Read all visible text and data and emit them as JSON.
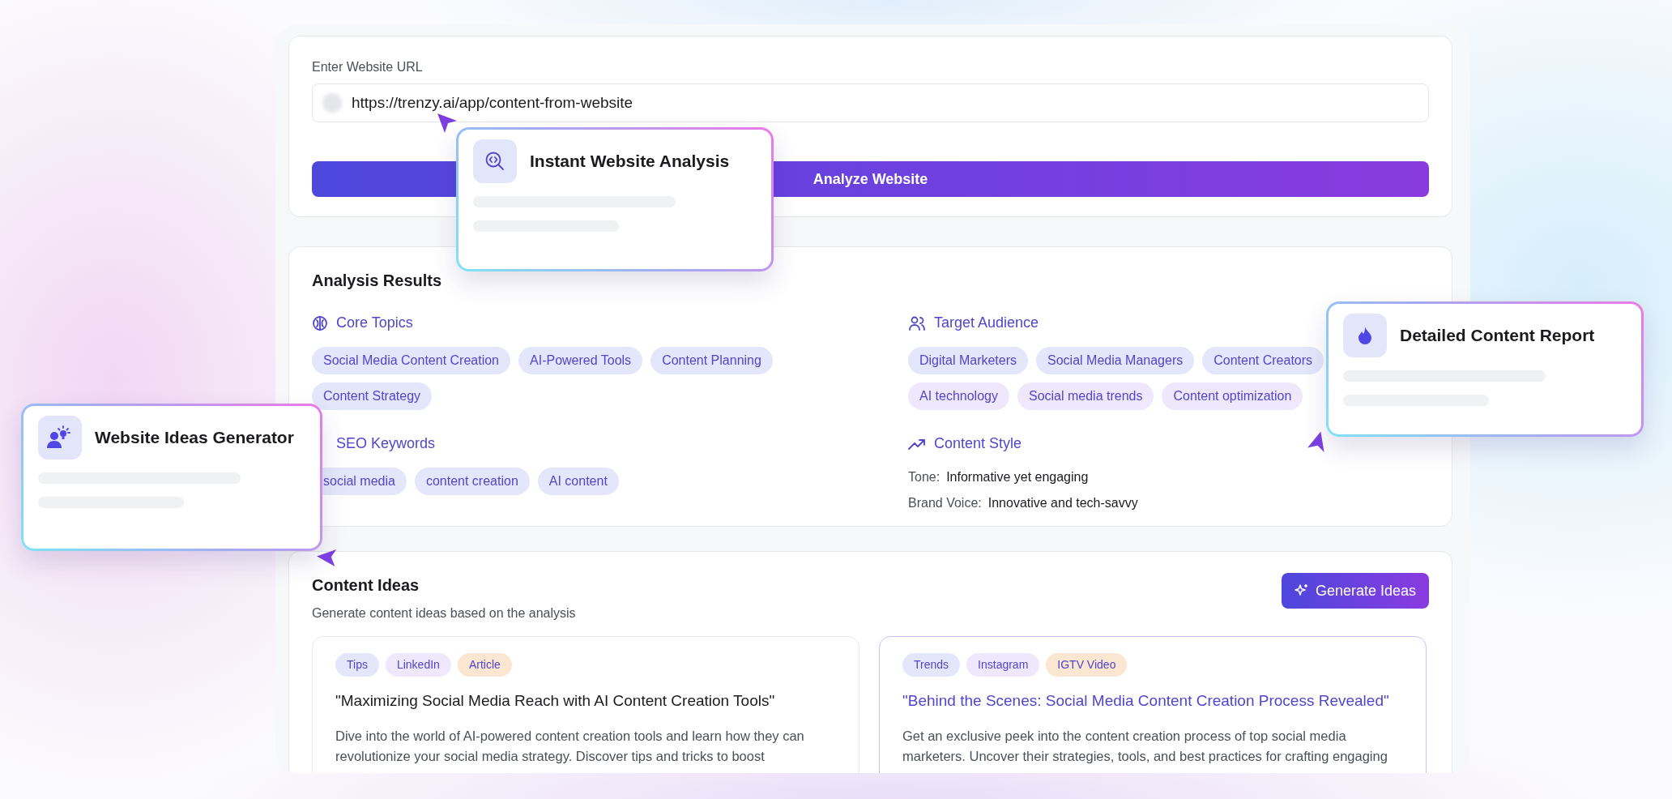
{
  "url_card": {
    "label": "Enter Website URL",
    "url": "https://trenzy.ai/app/content-from-website",
    "button": "Analyze Website"
  },
  "analysis": {
    "title": "Analysis Results",
    "columns": [
      [
        {
          "kind": "tags",
          "title": "Core Topics",
          "tags": [
            {
              "text": "Social Media Content Creation",
              "color": "#e4e7fb"
            },
            {
              "text": "AI-Powered Tools",
              "color": "#e4e7fb"
            },
            {
              "text": "Content Planning",
              "color": "#e4e7fb"
            },
            {
              "text": "Content Strategy",
              "color": "#e4e7fb"
            }
          ]
        },
        {
          "kind": "tags",
          "title": "SEO Keywords",
          "tags": [
            {
              "text": "social media",
              "color": "#e4e7fb"
            },
            {
              "text": "content creation",
              "color": "#e4e7fb"
            },
            {
              "text": "AI content",
              "color": "#e4e7fb"
            }
          ]
        }
      ],
      [
        {
          "kind": "tags",
          "title": "Target Audience",
          "tags": [
            {
              "text": "Digital Marketers",
              "color": "#e4e7fb"
            },
            {
              "text": "Social Media Managers",
              "color": "#e4e7fb"
            },
            {
              "text": "Content Creators",
              "color": "#e4e7fb"
            },
            {
              "text": "AI technology",
              "color": "#efe7fb"
            },
            {
              "text": "Social media trends",
              "color": "#efe7fb"
            },
            {
              "text": "Content optimization",
              "color": "#efe7fb"
            }
          ]
        },
        {
          "kind": "pairs",
          "title": "Content Style",
          "pairs": [
            {
              "label": "Tone:",
              "value": "Informative yet engaging"
            },
            {
              "label": "Brand Voice:",
              "value": "Innovative and tech-savvy"
            }
          ]
        }
      ]
    ]
  },
  "ideas": {
    "title": "Content Ideas",
    "subtitle": "Generate content ideas based on the analysis",
    "button": "Generate Ideas",
    "cards": [
      {
        "highlighted": false,
        "tags": [
          {
            "text": "Tips",
            "color": "#e4e7fb"
          },
          {
            "text": "LinkedIn",
            "color": "#efe7fb"
          },
          {
            "text": "Article",
            "color": "#fbe6d2"
          }
        ],
        "headline": "\"Maximizing Social Media Reach with AI Content Creation Tools\"",
        "description_lines": [
          "Dive into the world of AI-powered content creation tools and learn how they can",
          "revolutionize your social media strategy. Discover tips and tricks to boost"
        ]
      },
      {
        "highlighted": true,
        "tags": [
          {
            "text": "Trends",
            "color": "#e4e7fb"
          },
          {
            "text": "Instagram",
            "color": "#efe7fb"
          },
          {
            "text": "IGTV Video",
            "color": "#fbe6d2"
          }
        ],
        "headline": "\"Behind the Scenes: Social Media Content Creation Process Revealed\"",
        "description_lines": [
          "Get an exclusive peek into the content creation process of top social media",
          "marketers. Uncover their strategies, tools, and best practices for crafting engaging"
        ]
      }
    ]
  },
  "callouts": [
    {
      "title": "Instant Website Analysis"
    },
    {
      "title": "Detailed Content Report"
    },
    {
      "title": "Website Ideas Generator"
    }
  ]
}
